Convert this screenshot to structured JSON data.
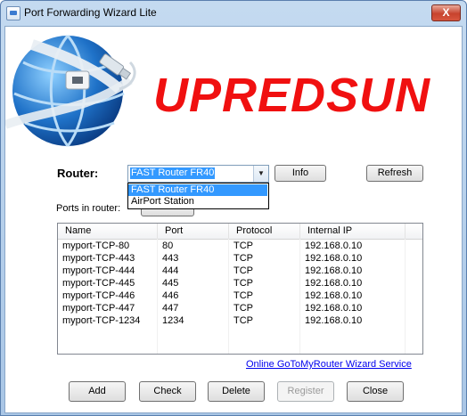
{
  "window": {
    "title": "Port Forwarding Wizard Lite",
    "close_glyph": "X"
  },
  "banner": {
    "brand": "UPREDSUN"
  },
  "router": {
    "label": "Router:",
    "selected": "FAST Router FR40",
    "options": [
      "FAST Router FR40",
      "AirPort Station"
    ],
    "info_button": "Info",
    "refresh_button": "Refresh"
  },
  "ports": {
    "label": "Ports in router:",
    "refresh_button": "Refresh",
    "columns": [
      "Name",
      "Port",
      "Protocol",
      "Internal IP"
    ],
    "rows": [
      [
        "myport-TCP-80",
        "80",
        "TCP",
        "192.168.0.10"
      ],
      [
        "myport-TCP-443",
        "443",
        "TCP",
        "192.168.0.10"
      ],
      [
        "myport-TCP-444",
        "444",
        "TCP",
        "192.168.0.10"
      ],
      [
        "myport-TCP-445",
        "445",
        "TCP",
        "192.168.0.10"
      ],
      [
        "myport-TCP-446",
        "446",
        "TCP",
        "192.168.0.10"
      ],
      [
        "myport-TCP-447",
        "447",
        "TCP",
        "192.168.0.10"
      ],
      [
        "myport-TCP-1234",
        "1234",
        "TCP",
        "192.168.0.10"
      ]
    ]
  },
  "link": {
    "text": "Online GoToMyRouter Wizard Service"
  },
  "buttons": {
    "add": "Add",
    "check": "Check",
    "delete": "Delete",
    "register": "Register",
    "close": "Close"
  },
  "colors": {
    "brand": "#f01010",
    "selection": "#3399ff",
    "link": "#0000ee"
  }
}
